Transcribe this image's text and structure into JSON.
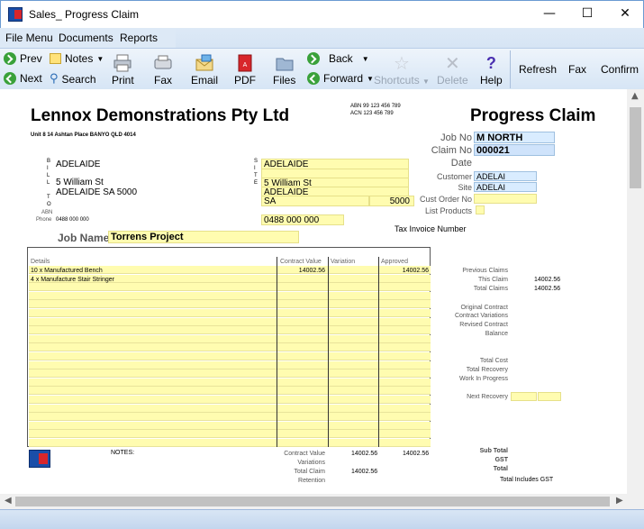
{
  "window": {
    "title": "Sales_ Progress Claim",
    "minimize": "—",
    "maximize": "☐",
    "close": "✕"
  },
  "menu": {
    "file": "File Menu",
    "documents": "Documents",
    "reports": "Reports"
  },
  "toolbar": {
    "prev": "Prev",
    "next": "Next",
    "notes": "Notes",
    "search": "Search",
    "print": "Print",
    "fax": "Fax",
    "email": "Email",
    "pdf": "PDF",
    "files": "Files",
    "back": "Back",
    "forward": "Forward",
    "shortcuts": "Shortcuts",
    "delete": "Delete",
    "help": "Help",
    "refresh": "Refresh",
    "fax2": "Fax",
    "confirm": "Confirm"
  },
  "doc": {
    "company": "Lennox Demonstrations Pty Ltd",
    "abn": "ABN 99 123 456 789",
    "acn": "ACN 123 456 789",
    "doc_title": "Progress Claim",
    "address_line": "Unit 8 14 Ashtan Place BANYO QLD 4014",
    "bill_to": {
      "line1": "ADELAIDE",
      "line2": "5 William St",
      "line3": "ADELAIDE SA 5000",
      "abn_label": "ABN",
      "phone_label": "Phone",
      "phone": "0488 000 000"
    },
    "site": {
      "line1": "ADELAIDE",
      "line2": "5 William St",
      "line3": "ADELAIDE",
      "line4": "SA",
      "postcode": "5000",
      "phone": "0488 000 000"
    },
    "job_no_label": "Job No",
    "job_no": "M NORTH",
    "claim_no_label": "Claim No",
    "claim_no": "000021",
    "date_label": "Date",
    "customer_label": "Customer",
    "customer": "ADELAI",
    "site_label": "Site",
    "site_val": "ADELAI",
    "cust_order_label": "Cust Order No",
    "list_products_label": "List Products",
    "tax_invoice": "Tax Invoice Number",
    "job_name_label": "Job Name",
    "job_name": "Torrens Project",
    "bill_letters": [
      "B",
      "I",
      "L",
      "L",
      "",
      "T",
      "O"
    ],
    "site_letters": [
      "S",
      "I",
      "T",
      "E"
    ],
    "table": {
      "headers": {
        "details": "Details",
        "contract": "Contract Value",
        "variation": "Variation",
        "approved": "Approved"
      },
      "rows": [
        {
          "details": "10 x  Manufactured Bench",
          "contract": "14002.56",
          "approved": "14002.56"
        },
        {
          "details": "4   x Manufacture Stair Stringer",
          "contract": "",
          "approved": ""
        }
      ]
    },
    "summary": {
      "previous_claims": "Previous Claims",
      "this_claim": "This Claim",
      "this_claim_val": "14002.56",
      "total_claims": "Total Claims",
      "total_claims_val": "14002.56",
      "original_contract": "Original Contract",
      "contract_variations": "Contract Variations",
      "revised_contract": "Revised Contract",
      "balance": "Balance",
      "total_cost": "Total Cost",
      "total_recovery": "Total Recovery",
      "wip": "Work In Progress",
      "next_recovery": "Next Recovery"
    },
    "footer": {
      "notes": "NOTES:",
      "contract_value": "Contract Value",
      "contract_value_val": "14002.56",
      "contract_value_approved": "14002.56",
      "variations": "Variations",
      "total_claim": "Total Claim",
      "total_claim_val": "14002.56",
      "retention": "Retention",
      "sub_total": "Sub Total",
      "gst": "GST",
      "total": "Total",
      "total_includes_gst": "Total Includes GST"
    }
  }
}
